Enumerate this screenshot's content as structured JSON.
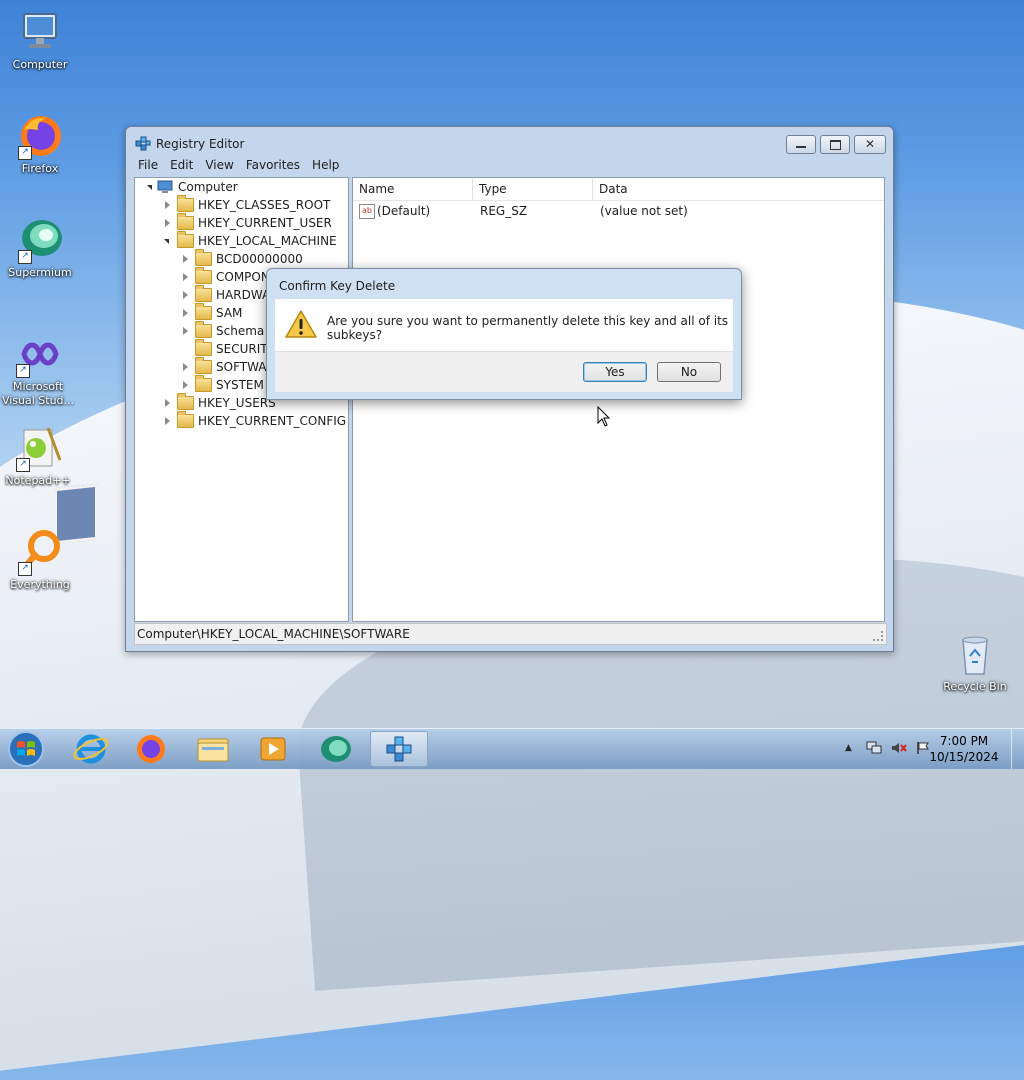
{
  "desktop": {
    "icons": [
      {
        "label": "Computer"
      },
      {
        "label": "Firefox"
      },
      {
        "label": "Supermium"
      },
      {
        "label": "Microsoft Visual Stud..."
      },
      {
        "label": "Notepad++"
      },
      {
        "label": "Everything"
      },
      {
        "label": "Recycle Bin"
      }
    ]
  },
  "regedit": {
    "title": "Registry Editor",
    "menu": [
      "File",
      "Edit",
      "View",
      "Favorites",
      "Help"
    ],
    "tree": {
      "root": "Computer",
      "hives": [
        "HKEY_CLASSES_ROOT",
        "HKEY_CURRENT_USER",
        "HKEY_LOCAL_MACHINE",
        "HKEY_USERS",
        "HKEY_CURRENT_CONFIG"
      ],
      "hklm_children": [
        "BCD00000000",
        "COMPON",
        "HARDWA",
        "SAM",
        "Schema",
        "SECURITY",
        "SOFTWAR",
        "SYSTEM"
      ]
    },
    "columns": [
      "Name",
      "Type",
      "Data"
    ],
    "rows": [
      {
        "name": "(Default)",
        "type": "REG_SZ",
        "data": "(value not set)"
      }
    ],
    "status": "Computer\\HKEY_LOCAL_MACHINE\\SOFTWARE"
  },
  "dialog": {
    "title": "Confirm Key Delete",
    "message": "Are you sure you want to permanently delete this key and all of its subkeys?",
    "yes": "Yes",
    "no": "No"
  },
  "taskbar": {
    "time": "7:00 PM",
    "date": "10/15/2024"
  }
}
